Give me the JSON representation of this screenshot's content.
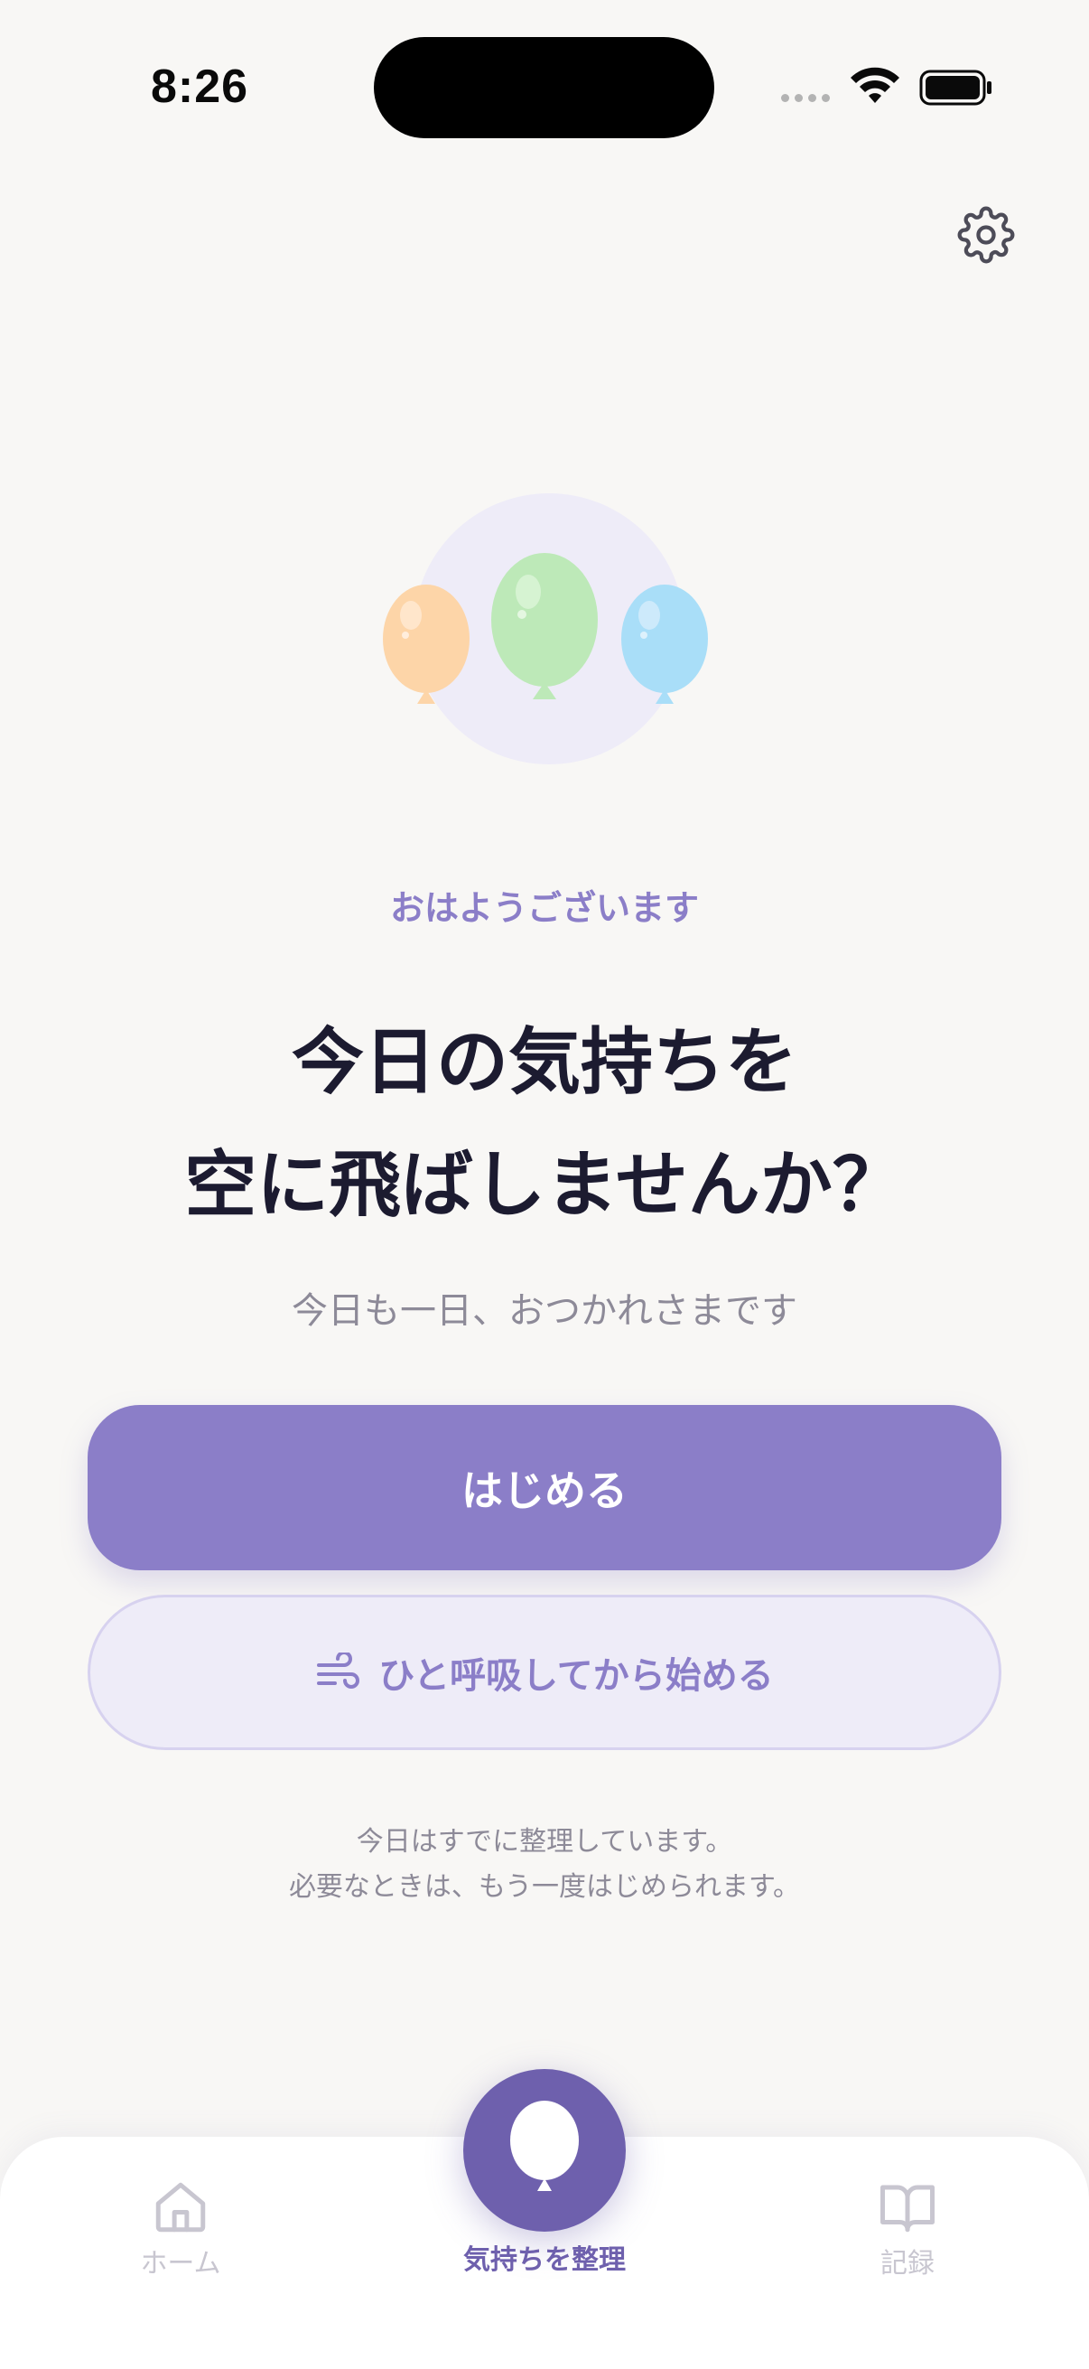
{
  "status_bar": {
    "time": "8:26"
  },
  "icons": {
    "settings": "gear-icon",
    "wifi": "wifi-icon",
    "battery": "battery-icon",
    "breath": "wind-icon",
    "home": "home-icon",
    "records": "book-icon",
    "center": "balloon-icon"
  },
  "hero": {
    "balloons": [
      {
        "name": "orange-balloon",
        "color": "#fdd5a8"
      },
      {
        "name": "green-balloon",
        "color": "#bde9b8"
      },
      {
        "name": "blue-balloon",
        "color": "#a9def8"
      }
    ],
    "circle_color": "#eeecf8"
  },
  "main": {
    "greeting": "おはようございます",
    "headline_line1": "今日の気持ちを",
    "headline_line2": "空に飛ばしませんか？",
    "subtext": "今日も一日、おつかれさまです",
    "primary_button": "はじめる",
    "secondary_button": "ひと呼吸してから始める",
    "note_line1": "今日はすでに整理しています。",
    "note_line2": "必要なときは、もう一度はじめられます。"
  },
  "tab_bar": {
    "home": "ホーム",
    "center": "気持ちを整理",
    "records": "記録"
  },
  "colors": {
    "accent": "#8b7ec8",
    "accent_dark": "#6e60ad",
    "background": "#f8f7f5",
    "text_dark": "#1c1b30",
    "text_muted": "#8d8a98",
    "tab_inactive": "#c8c6d0"
  }
}
